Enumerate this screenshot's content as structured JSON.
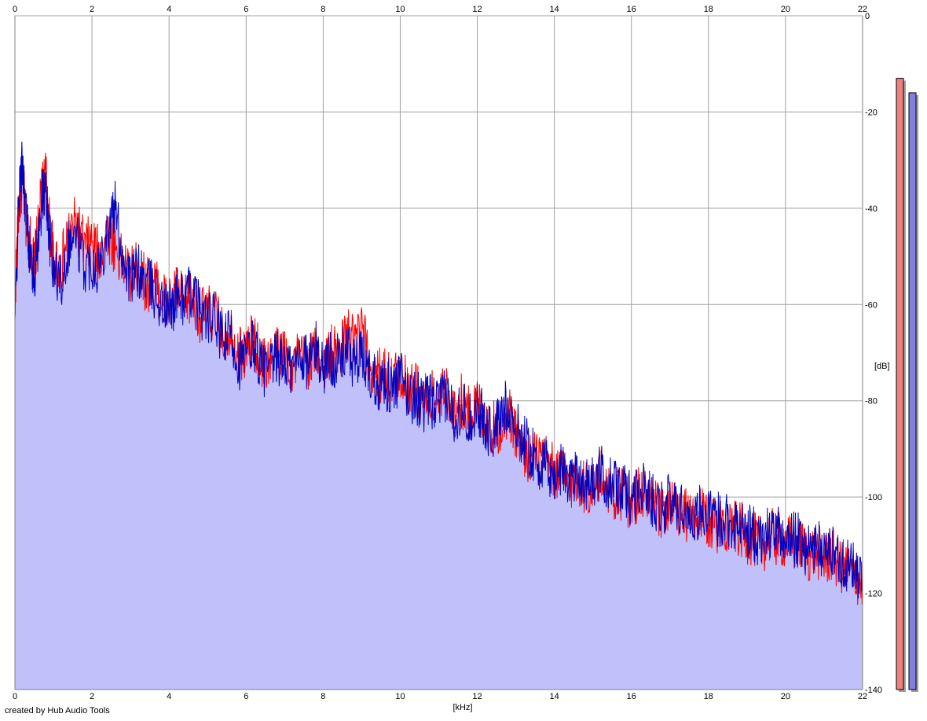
{
  "credit": "created by Hub Audio Tools",
  "chart_data": {
    "type": "area",
    "xlabel": "[kHz]",
    "ylabel": "[dB]",
    "xlim": [
      0,
      22
    ],
    "ylim": [
      -140,
      0
    ],
    "grid": true,
    "x_ticks": [
      "0",
      "2",
      "4",
      "6",
      "8",
      "10",
      "12",
      "14",
      "16",
      "18",
      "20",
      "22"
    ],
    "y_ticks": [
      "0",
      "-20",
      "-40",
      "-60",
      "-80",
      "-100",
      "-120",
      "-140"
    ],
    "colors": {
      "red_series": "#ff0000",
      "blue_series": "#0000c0",
      "fill": "#c0c0fa",
      "fill_red": "#f4b4c8",
      "grid": "#a0a0a0",
      "red_meter": "#f08080",
      "blue_meter": "#8080e0"
    },
    "series": [
      {
        "color": "red",
        "x": [
          0,
          0.1,
          0.2,
          0.3,
          0.4,
          0.5,
          0.6,
          0.7,
          0.8,
          0.9,
          1.0,
          1.2,
          1.4,
          1.6,
          1.8,
          2.0,
          2.2,
          2.4,
          2.6,
          2.8,
          3.0,
          3.2,
          3.4,
          3.6,
          3.8,
          4.0,
          4.2,
          4.4,
          4.6,
          4.8,
          5.0,
          5.2,
          5.4,
          5.6,
          5.8,
          6.0,
          6.2,
          6.4,
          6.6,
          6.8,
          7.0,
          7.2,
          7.4,
          7.6,
          7.8,
          8.0,
          8.2,
          8.4,
          8.6,
          8.8,
          9.0,
          9.2,
          9.4,
          9.6,
          9.8,
          10.0,
          10.2,
          10.4,
          10.6,
          10.8,
          11.0,
          11.2,
          11.4,
          11.6,
          11.8,
          12.0,
          12.2,
          12.4,
          12.6,
          12.8,
          13.0,
          13.2,
          13.4,
          13.6,
          13.8,
          14.0,
          14.2,
          14.4,
          14.6,
          14.8,
          15.0,
          15.2,
          15.4,
          15.6,
          15.8,
          16.0,
          16.2,
          16.4,
          16.6,
          16.8,
          17.0,
          17.2,
          17.4,
          17.6,
          17.8,
          18.0,
          18.2,
          18.4,
          18.6,
          18.8,
          19.0,
          19.2,
          19.4,
          19.6,
          19.8,
          20.0,
          20.2,
          20.4,
          20.6,
          20.8,
          21.0,
          21.2,
          21.4,
          21.6,
          21.8,
          22.0
        ],
        "y": [
          -58,
          -40,
          -34,
          -44,
          -47,
          -52,
          -45,
          -36,
          -33,
          -44,
          -50,
          -52,
          -45,
          -43,
          -48,
          -47,
          -50,
          -45,
          -48,
          -52,
          -54,
          -52,
          -56,
          -55,
          -58,
          -60,
          -57,
          -60,
          -58,
          -62,
          -62,
          -62,
          -67,
          -65,
          -70,
          -70,
          -67,
          -72,
          -72,
          -70,
          -70,
          -73,
          -71,
          -72,
          -70,
          -72,
          -70,
          -71,
          -66,
          -68,
          -65,
          -72,
          -75,
          -74,
          -76,
          -74,
          -77,
          -77,
          -80,
          -79,
          -80,
          -78,
          -82,
          -80,
          -83,
          -80,
          -84,
          -86,
          -85,
          -82,
          -87,
          -90,
          -92,
          -92,
          -93,
          -95,
          -95,
          -97,
          -96,
          -98,
          -98,
          -96,
          -98,
          -99,
          -100,
          -101,
          -99,
          -100,
          -102,
          -103,
          -102,
          -103,
          -104,
          -105,
          -104,
          -105,
          -106,
          -105,
          -106,
          -107,
          -108,
          -109,
          -110,
          -108,
          -109,
          -109,
          -110,
          -110,
          -112,
          -111,
          -113,
          -112,
          -114,
          -115,
          -116,
          -118
        ]
      },
      {
        "color": "blue",
        "x": [
          0,
          0.1,
          0.2,
          0.3,
          0.4,
          0.5,
          0.6,
          0.7,
          0.8,
          0.9,
          1.0,
          1.2,
          1.4,
          1.6,
          1.8,
          2.0,
          2.2,
          2.4,
          2.6,
          2.8,
          3.0,
          3.2,
          3.4,
          3.6,
          3.8,
          4.0,
          4.2,
          4.4,
          4.6,
          4.8,
          5.0,
          5.2,
          5.4,
          5.6,
          5.8,
          6.0,
          6.2,
          6.4,
          6.6,
          6.8,
          7.0,
          7.2,
          7.4,
          7.6,
          7.8,
          8.0,
          8.2,
          8.4,
          8.6,
          8.8,
          9.0,
          9.2,
          9.4,
          9.6,
          9.8,
          10.0,
          10.2,
          10.4,
          10.6,
          10.8,
          11.0,
          11.2,
          11.4,
          11.6,
          11.8,
          12.0,
          12.2,
          12.4,
          12.6,
          12.8,
          13.0,
          13.2,
          13.4,
          13.6,
          13.8,
          14.0,
          14.2,
          14.4,
          14.6,
          14.8,
          15.0,
          15.2,
          15.4,
          15.6,
          15.8,
          16.0,
          16.2,
          16.4,
          16.6,
          16.8,
          17.0,
          17.2,
          17.4,
          17.6,
          17.8,
          18.0,
          18.2,
          18.4,
          18.6,
          18.8,
          19.0,
          19.2,
          19.4,
          19.6,
          19.8,
          20.0,
          20.2,
          20.4,
          20.6,
          20.8,
          21.0,
          21.2,
          21.4,
          21.6,
          21.8,
          22.0
        ],
        "y": [
          -64,
          -38,
          -30,
          -42,
          -50,
          -54,
          -47,
          -38,
          -36,
          -46,
          -53,
          -55,
          -47,
          -46,
          -52,
          -51,
          -52,
          -44,
          -40,
          -50,
          -55,
          -53,
          -55,
          -57,
          -60,
          -62,
          -58,
          -59,
          -57,
          -61,
          -63,
          -63,
          -68,
          -66,
          -72,
          -71,
          -68,
          -73,
          -74,
          -71,
          -72,
          -74,
          -70,
          -72,
          -69,
          -73,
          -71,
          -72,
          -69,
          -72,
          -71,
          -74,
          -76,
          -76,
          -78,
          -75,
          -79,
          -79,
          -81,
          -80,
          -81,
          -79,
          -83,
          -81,
          -84,
          -81,
          -85,
          -87,
          -84,
          -80,
          -86,
          -88,
          -91,
          -93,
          -94,
          -96,
          -94,
          -96,
          -95,
          -97,
          -97,
          -95,
          -97,
          -98,
          -99,
          -100,
          -98,
          -99,
          -101,
          -102,
          -101,
          -102,
          -103,
          -104,
          -103,
          -104,
          -105,
          -104,
          -105,
          -106,
          -107,
          -108,
          -109,
          -107,
          -108,
          -108,
          -109,
          -109,
          -111,
          -110,
          -112,
          -111,
          -113,
          -114,
          -115,
          -117
        ]
      }
    ],
    "meters": [
      {
        "color": "red",
        "level_db": -13
      },
      {
        "color": "blue",
        "level_db": -16
      }
    ]
  }
}
